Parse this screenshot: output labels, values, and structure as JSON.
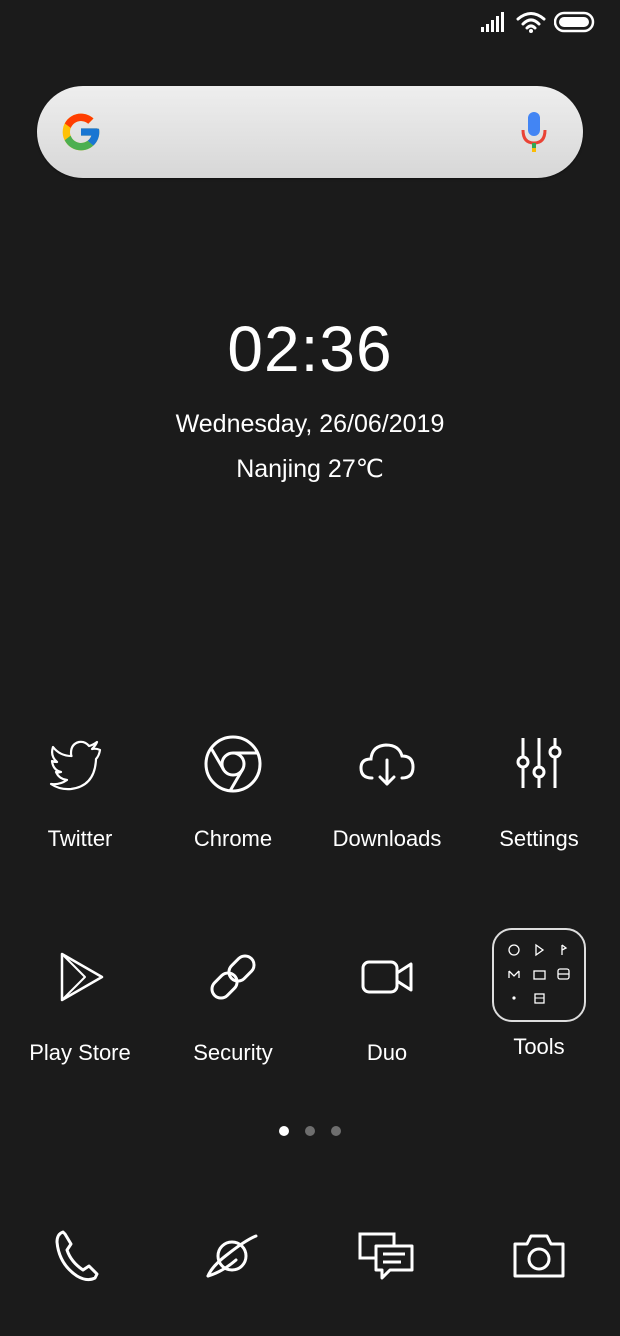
{
  "status_bar": {
    "signal_icon": "signal-bars-icon",
    "wifi_icon": "wifi-icon",
    "battery_icon": "battery-icon"
  },
  "search": {
    "logo_icon": "google-logo-icon",
    "mic_icon": "microphone-icon"
  },
  "clock": {
    "time": "02:36",
    "date": "Wednesday, 26/06/2019",
    "weather": "Nanjing 27℃"
  },
  "apps": [
    {
      "label": "Twitter",
      "icon": "twitter-bird-icon"
    },
    {
      "label": "Chrome",
      "icon": "chrome-icon"
    },
    {
      "label": "Downloads",
      "icon": "cloud-download-icon"
    },
    {
      "label": "Settings",
      "icon": "sliders-icon"
    },
    {
      "label": "Play Store",
      "icon": "play-store-icon"
    },
    {
      "label": "Security",
      "icon": "link-icon"
    },
    {
      "label": "Duo",
      "icon": "video-camera-icon"
    },
    {
      "label": "Tools",
      "icon": "folder-icon"
    }
  ],
  "page_indicator": {
    "count": 3,
    "active_index": 0
  },
  "dock": [
    {
      "icon": "phone-icon"
    },
    {
      "icon": "browser-orbit-icon"
    },
    {
      "icon": "messages-icon"
    },
    {
      "icon": "camera-icon"
    }
  ],
  "colors": {
    "background": "#1b1b1b",
    "text": "#ffffff",
    "dot_active": "#ffffff",
    "dot_inactive": "#6e6e6e"
  }
}
